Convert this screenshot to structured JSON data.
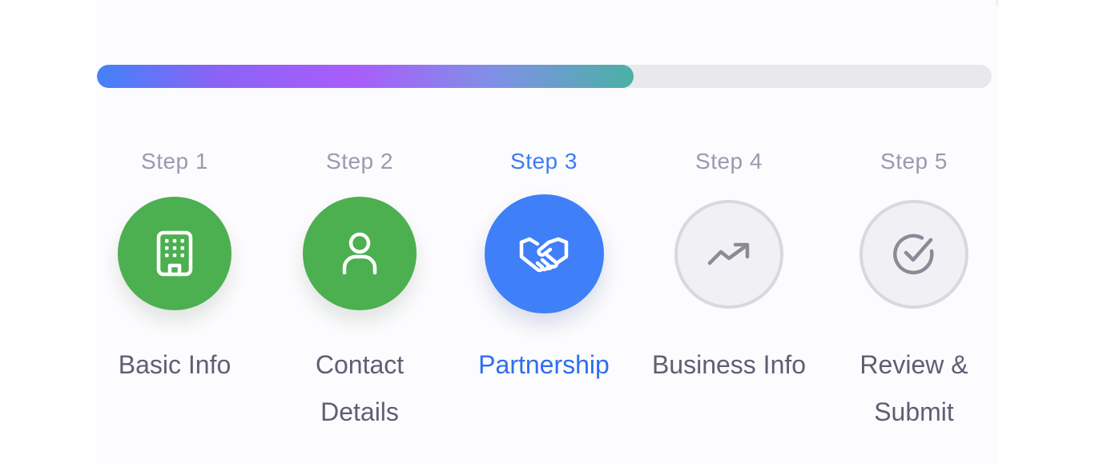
{
  "progress": {
    "percent": 60
  },
  "steps": [
    {
      "number_label": "Step 1",
      "label": "Basic Info",
      "status": "done",
      "icon": "building-icon"
    },
    {
      "number_label": "Step 2",
      "label": "Contact Details",
      "status": "done",
      "icon": "user-icon"
    },
    {
      "number_label": "Step 3",
      "label": "Partnership",
      "status": "current",
      "icon": "handshake-icon"
    },
    {
      "number_label": "Step 4",
      "label": "Business Info",
      "status": "pending",
      "icon": "trending-up-icon"
    },
    {
      "number_label": "Step 5",
      "label": "Review & Submit",
      "status": "pending",
      "icon": "check-circle-icon"
    }
  ],
  "colors": {
    "done": "#4caf50",
    "current": "#3f7ff8",
    "pending_bg": "#f1f1f5",
    "pending_border": "#d8d8e0",
    "label": "#5f5f73",
    "current_label": "#2d6ef1",
    "step_number": "#9a9aaf",
    "track": "#e8e8ed"
  }
}
